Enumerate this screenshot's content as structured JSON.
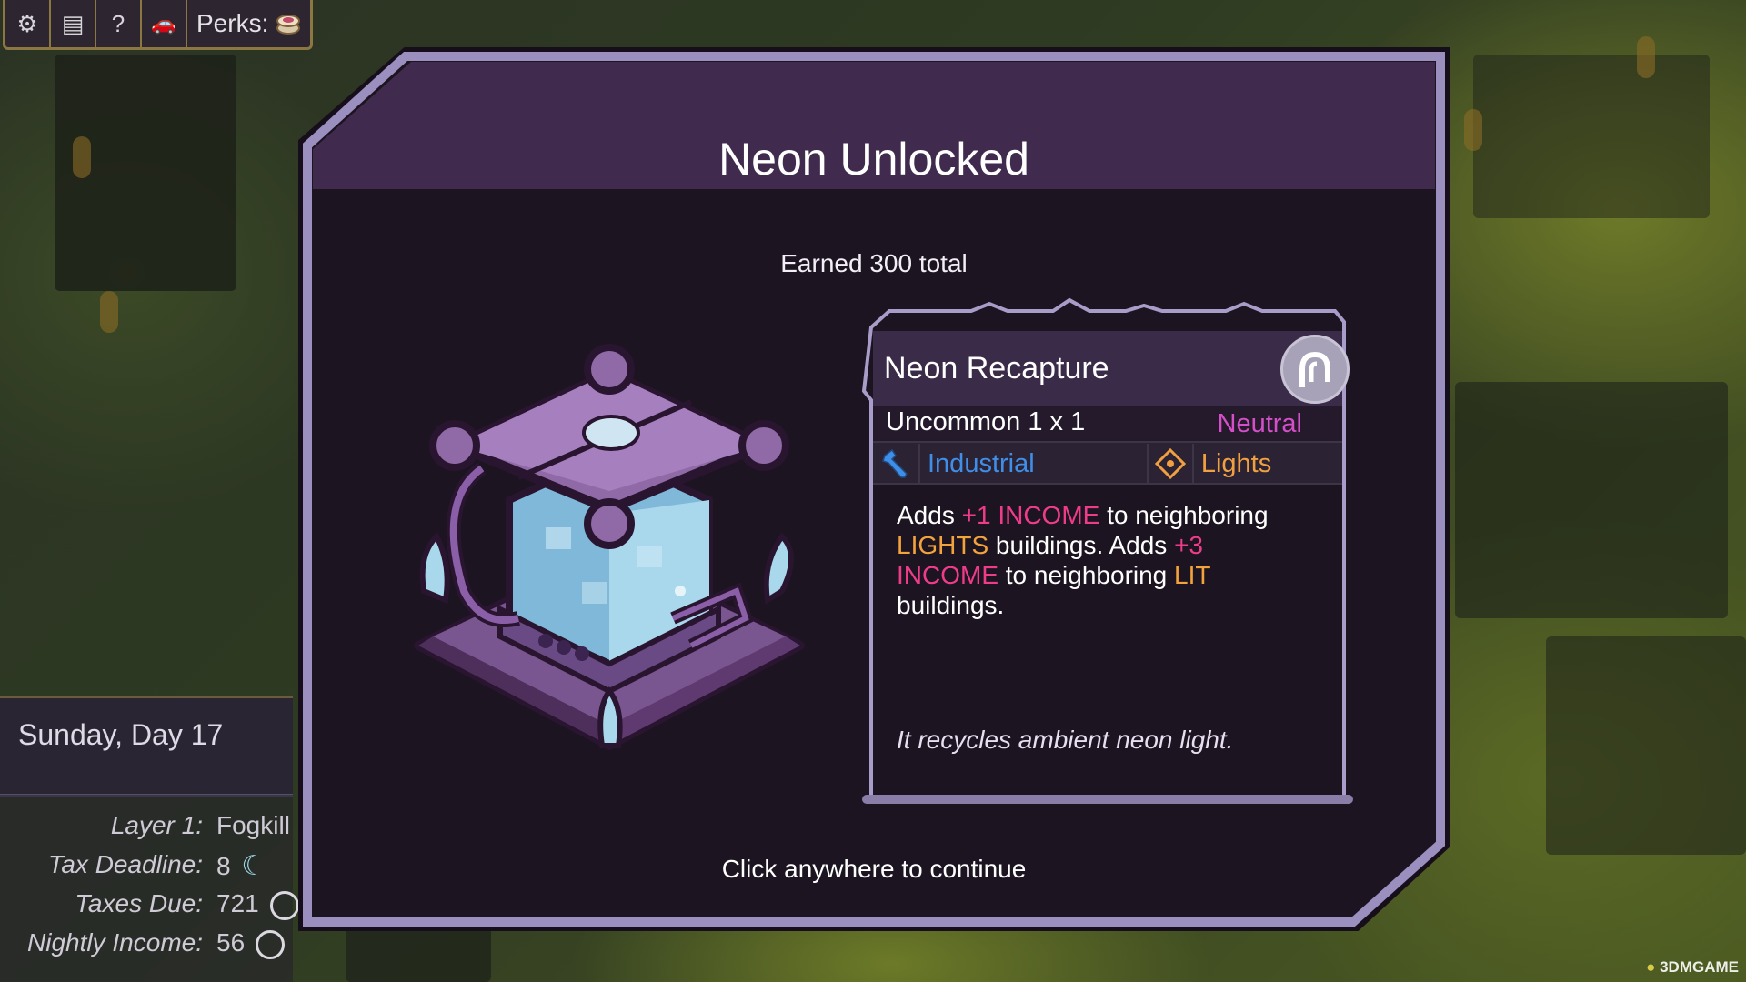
{
  "toolbar": {
    "buttons": [
      {
        "name": "settings-button",
        "icon": "gear-icon",
        "glyph": "⚙"
      },
      {
        "name": "log-button",
        "icon": "notes-icon",
        "glyph": "▤"
      },
      {
        "name": "help-button",
        "icon": "question-icon",
        "glyph": "?"
      },
      {
        "name": "vehicle-button",
        "icon": "car-icon",
        "glyph": "🚗"
      }
    ],
    "perks_label": "Perks:"
  },
  "hud": {
    "date": "Sunday, Day 17",
    "stats": [
      {
        "label": "Layer 1:",
        "value": "Fogkill"
      },
      {
        "label": "Tax Deadline:",
        "value": "8"
      },
      {
        "label": "Taxes Due:",
        "value": "721"
      },
      {
        "label": "Nightly Income:",
        "value": "56"
      }
    ]
  },
  "modal": {
    "title": "Neon Unlocked",
    "subtitle": "Earned 300 total",
    "footer": "Click anywhere to continue"
  },
  "card": {
    "name": "Neon Recapture",
    "rarity": "Uncommon 1 x 1",
    "affinity": "Neutral",
    "tags": [
      "Industrial",
      "Lights"
    ],
    "description": {
      "p1": "Adds ",
      "inc1": "+1 INCOME",
      "p2": " to neighboring ",
      "lights": "LIGHTS",
      "p3": " buildings. Adds ",
      "inc2a": "+3",
      "inc2b": "INCOME",
      "p4": " to neighboring ",
      "lit": "LIT",
      "p5": "buildings."
    },
    "flavor": "It recycles ambient neon light."
  },
  "colors": {
    "frame": "#9b8fbf",
    "panel_header": "#402a4e",
    "panel_body": "#1c1421",
    "income": "#ef3c8a",
    "lights": "#f2a33c",
    "industrial": "#3f8fe8",
    "neutral": "#d44fc8"
  },
  "watermark": "3DMGAME"
}
